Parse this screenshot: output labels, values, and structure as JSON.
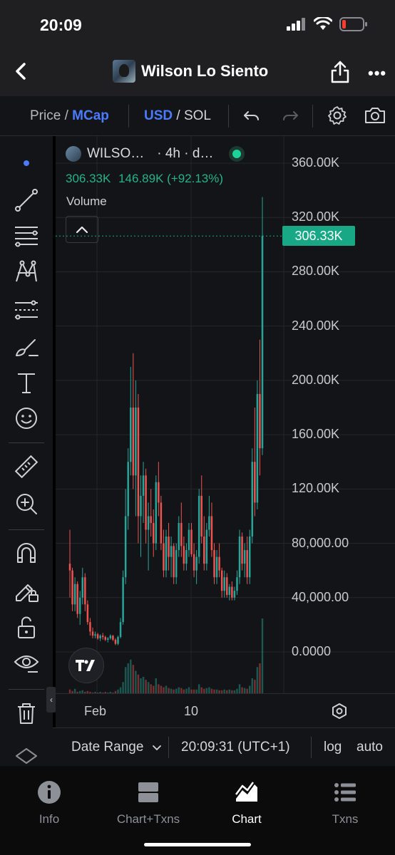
{
  "status_bar": {
    "time": "20:09"
  },
  "header": {
    "title": "Wilson Lo Siento"
  },
  "toolbar": {
    "price_label": "Price",
    "sep1": " / ",
    "mcap_label": "MCap",
    "currency_usd": "USD",
    "sep2": " / ",
    "currency_sol": "SOL"
  },
  "legend": {
    "symbol": "WILSO…",
    "interval": "· 4h · d…",
    "ohlc_value": "306.33K",
    "ohlc_change": "146.89K (+92.13%)",
    "volume_label": "Volume",
    "current_price_tag": "306.33K"
  },
  "xaxis": {
    "labels": [
      "Feb",
      "10"
    ]
  },
  "range_bar": {
    "date_range_label": "Date Range",
    "time": "20:09:31 (UTC+1)",
    "log_label": "log",
    "auto_label": "auto"
  },
  "bottom_nav": [
    {
      "label": "Info",
      "icon": "info-icon"
    },
    {
      "label": "Chart+Txns",
      "icon": "split-icon"
    },
    {
      "label": "Chart",
      "icon": "chart-icon",
      "active": true
    },
    {
      "label": "Txns",
      "icon": "list-icon"
    }
  ],
  "colors": {
    "up": "#26a69a",
    "down": "#ef5350",
    "accent": "#4a7bff",
    "tag": "#18a886"
  },
  "chart_data": {
    "type": "candlestick",
    "yaxis_ticks": [
      "360.00K",
      "320.00K",
      "280.00K",
      "240.00K",
      "200.00K",
      "160.00K",
      "120.00K",
      "80,000.00",
      "40,000.00",
      "0.0000"
    ],
    "ylim": [
      0,
      360000
    ],
    "xaxis_ticks": [
      "Feb",
      "10"
    ],
    "current_value": 306330,
    "change": "146.89K (+92.13%)",
    "candles": [
      [
        65000,
        90000,
        40000,
        60000
      ],
      [
        60000,
        62000,
        30000,
        35000
      ],
      [
        35000,
        55000,
        30000,
        50000
      ],
      [
        50000,
        52000,
        25000,
        28000
      ],
      [
        28000,
        45000,
        20000,
        40000
      ],
      [
        40000,
        62000,
        35000,
        55000
      ],
      [
        55000,
        58000,
        30000,
        35000
      ],
      [
        35000,
        38000,
        20000,
        22000
      ],
      [
        22000,
        25000,
        12000,
        15000
      ],
      [
        15000,
        18000,
        10000,
        12000
      ],
      [
        12000,
        15000,
        10000,
        13000
      ],
      [
        13000,
        14000,
        9000,
        10000
      ],
      [
        10000,
        13000,
        8000,
        12000
      ],
      [
        12000,
        14000,
        9000,
        11000
      ],
      [
        11000,
        12000,
        8000,
        9000
      ],
      [
        9000,
        11000,
        7000,
        10000
      ],
      [
        10000,
        13000,
        9000,
        12000
      ],
      [
        12000,
        12500,
        8000,
        9000
      ],
      [
        9000,
        10000,
        5000,
        6000
      ],
      [
        6000,
        12000,
        5000,
        11000
      ],
      [
        11000,
        25000,
        10000,
        22000
      ],
      [
        22000,
        60000,
        20000,
        55000
      ],
      [
        55000,
        120000,
        50000,
        100000
      ],
      [
        100000,
        150000,
        90000,
        140000
      ],
      [
        140000,
        210000,
        130000,
        180000
      ],
      [
        180000,
        220000,
        120000,
        130000
      ],
      [
        130000,
        200000,
        100000,
        180000
      ],
      [
        180000,
        190000,
        80000,
        100000
      ],
      [
        100000,
        130000,
        70000,
        115000
      ],
      [
        115000,
        140000,
        95000,
        130000
      ],
      [
        130000,
        135000,
        80000,
        90000
      ],
      [
        90000,
        110000,
        60000,
        100000
      ],
      [
        100000,
        120000,
        85000,
        95000
      ],
      [
        95000,
        105000,
        70000,
        80000
      ],
      [
        80000,
        130000,
        75000,
        125000
      ],
      [
        125000,
        140000,
        100000,
        110000
      ],
      [
        110000,
        115000,
        75000,
        80000
      ],
      [
        80000,
        90000,
        55000,
        60000
      ],
      [
        60000,
        90000,
        55000,
        85000
      ],
      [
        85000,
        95000,
        60000,
        70000
      ],
      [
        70000,
        85000,
        55000,
        78000
      ],
      [
        78000,
        80000,
        50000,
        55000
      ],
      [
        55000,
        80000,
        50000,
        75000
      ],
      [
        75000,
        100000,
        70000,
        95000
      ],
      [
        95000,
        110000,
        70000,
        78000
      ],
      [
        78000,
        85000,
        60000,
        65000
      ],
      [
        65000,
        80000,
        60000,
        75000
      ],
      [
        75000,
        95000,
        70000,
        90000
      ],
      [
        90000,
        95000,
        70000,
        72000
      ],
      [
        72000,
        80000,
        55000,
        60000
      ],
      [
        60000,
        75000,
        50000,
        70000
      ],
      [
        70000,
        120000,
        65000,
        115000
      ],
      [
        115000,
        130000,
        80000,
        85000
      ],
      [
        85000,
        100000,
        60000,
        65000
      ],
      [
        65000,
        95000,
        60000,
        90000
      ],
      [
        90000,
        115000,
        85000,
        100000
      ],
      [
        100000,
        110000,
        70000,
        75000
      ],
      [
        75000,
        80000,
        50000,
        55000
      ],
      [
        55000,
        75000,
        50000,
        70000
      ],
      [
        70000,
        80000,
        55000,
        60000
      ],
      [
        60000,
        62000,
        40000,
        45000
      ],
      [
        45000,
        60000,
        40000,
        55000
      ],
      [
        55000,
        58000,
        40000,
        42000
      ],
      [
        42000,
        50000,
        38000,
        48000
      ],
      [
        48000,
        52000,
        38000,
        40000
      ],
      [
        40000,
        48000,
        38000,
        45000
      ],
      [
        45000,
        60000,
        42000,
        55000
      ],
      [
        55000,
        90000,
        50000,
        85000
      ],
      [
        85000,
        88000,
        60000,
        65000
      ],
      [
        65000,
        80000,
        55000,
        75000
      ],
      [
        75000,
        85000,
        50000,
        55000
      ],
      [
        55000,
        90000,
        50000,
        85000
      ],
      [
        85000,
        150000,
        80000,
        140000
      ],
      [
        140000,
        180000,
        100000,
        110000
      ],
      [
        110000,
        200000,
        105000,
        190000
      ],
      [
        190000,
        230000,
        130000,
        150000
      ],
      [
        150000,
        335000,
        145000,
        306330
      ]
    ],
    "volume_rel": [
      0.05,
      0.03,
      0.06,
      0.02,
      0.03,
      0.04,
      0.02,
      0.03,
      0.02,
      0.01,
      0.02,
      0.01,
      0.02,
      0.01,
      0.02,
      0.01,
      0.02,
      0.01,
      0.03,
      0.05,
      0.08,
      0.15,
      0.35,
      0.4,
      0.45,
      0.38,
      0.3,
      0.25,
      0.2,
      0.22,
      0.18,
      0.15,
      0.12,
      0.1,
      0.2,
      0.12,
      0.1,
      0.08,
      0.1,
      0.07,
      0.06,
      0.05,
      0.06,
      0.08,
      0.07,
      0.05,
      0.06,
      0.08,
      0.05,
      0.05,
      0.05,
      0.12,
      0.08,
      0.06,
      0.07,
      0.08,
      0.06,
      0.05,
      0.05,
      0.04,
      0.04,
      0.05,
      0.04,
      0.05,
      0.04,
      0.04,
      0.06,
      0.12,
      0.08,
      0.07,
      0.06,
      0.1,
      0.2,
      0.18,
      0.35,
      0.4,
      1.0
    ]
  }
}
